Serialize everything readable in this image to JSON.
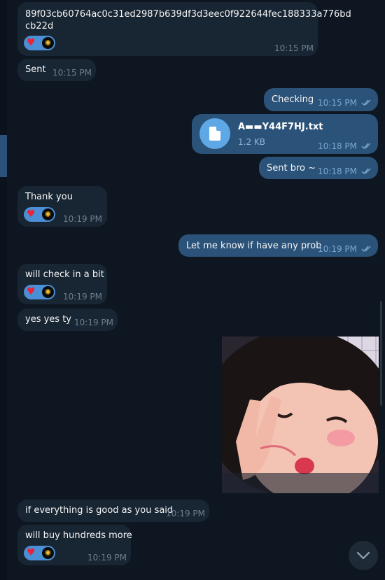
{
  "colors": {
    "background": "#0e1621",
    "incoming_bubble": "#182533",
    "outgoing_bubble": "#2b5278",
    "reaction_pill": "#4b8fd6",
    "heart": "#e8243a",
    "file_icon_bg": "#5fa8e6"
  },
  "messages": [
    {
      "type": "incoming",
      "text_line1": "89f03cb60764ac0c31ed2987b639df3d3eec0f922644fec188333a776bd",
      "text_line2": "cb22d",
      "time": "10:15 PM",
      "reactions": [
        "heart",
        "avatar"
      ]
    },
    {
      "type": "incoming",
      "text": "Sent",
      "time": "10:15 PM"
    },
    {
      "type": "outgoing",
      "text": "Checking",
      "time": "10:15 PM",
      "status": "read"
    },
    {
      "type": "outgoing-file",
      "file_name": "A▬▬Y44F7HJ.txt",
      "file_size": "1.2 KB",
      "time": "10:18 PM",
      "status": "read",
      "icon": "file-icon"
    },
    {
      "type": "outgoing",
      "text": "Sent bro ~",
      "time": "10:18 PM",
      "status": "read"
    },
    {
      "type": "incoming",
      "text": "Thank you",
      "time": "10:19 PM",
      "reactions": [
        "heart",
        "avatar"
      ]
    },
    {
      "type": "outgoing",
      "text": "Let me know if have any prob",
      "time": "10:19 PM",
      "status": "read"
    },
    {
      "type": "incoming",
      "text": "will check in a bit",
      "time": "10:19 PM",
      "reactions": [
        "heart",
        "avatar"
      ]
    },
    {
      "type": "incoming",
      "text": "yes yes ty",
      "time": "10:19 PM"
    },
    {
      "type": "outgoing-photo",
      "description_icon": "photo"
    },
    {
      "type": "incoming",
      "text": "if everything is good as you said",
      "time": "10:19 PM"
    },
    {
      "type": "incoming",
      "text": "will buy hundreds more",
      "time": "10:19 PM",
      "reactions": [
        "heart",
        "avatar"
      ]
    }
  ],
  "icons": {
    "heart": "♥",
    "avatar": "✺",
    "scroll_down": "chevron-down-icon"
  }
}
